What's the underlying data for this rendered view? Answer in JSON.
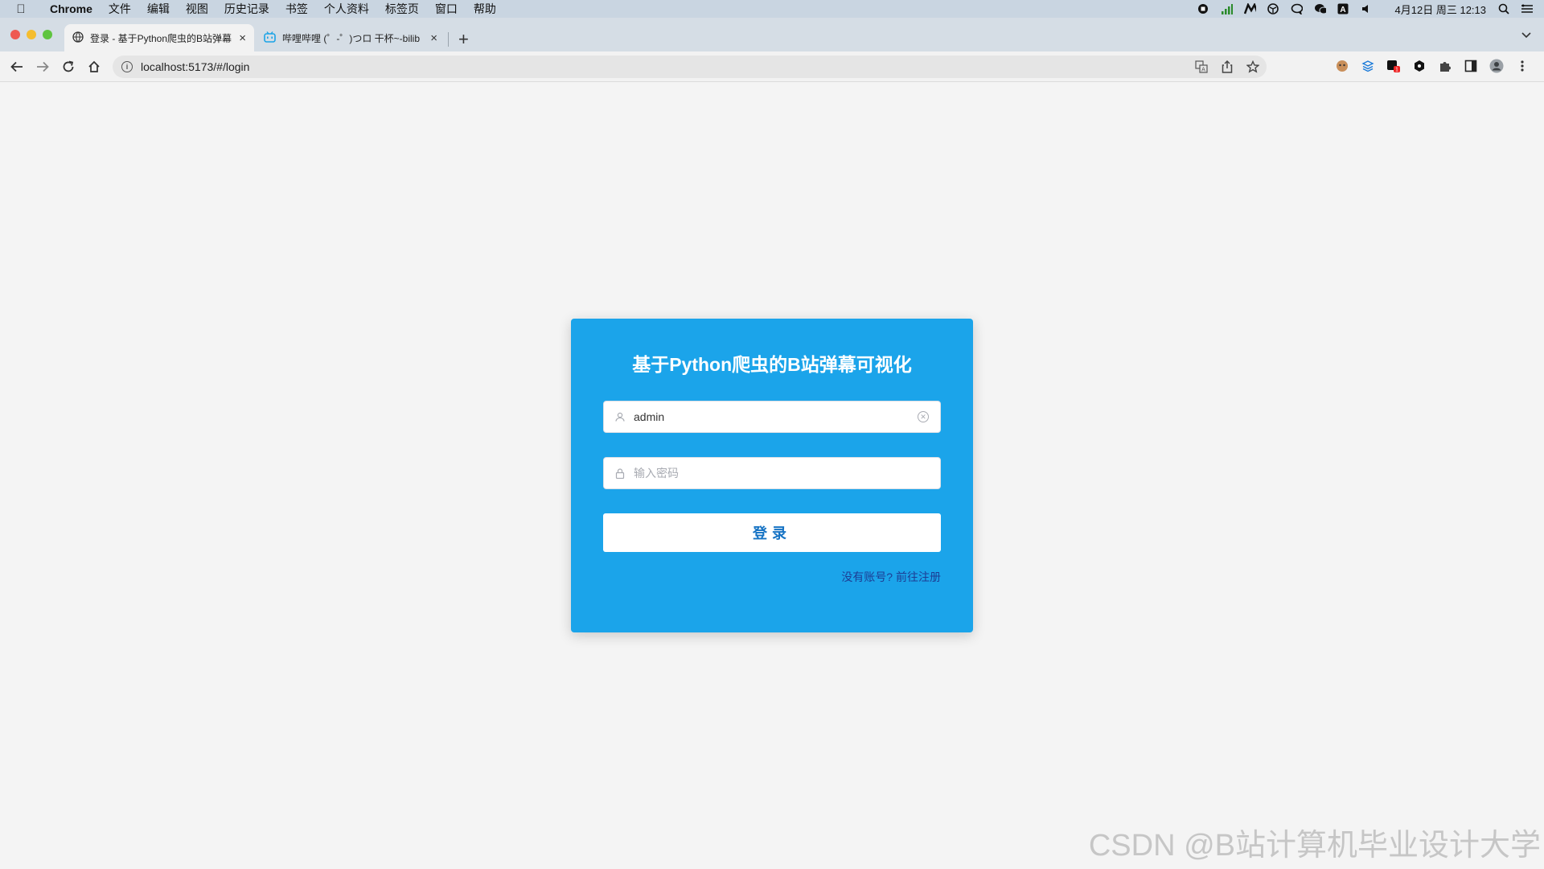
{
  "menubar": {
    "app_name": "Chrome",
    "items": [
      "文件",
      "编辑",
      "视图",
      "历史记录",
      "书签",
      "个人资料",
      "标签页",
      "窗口",
      "帮助"
    ],
    "clock": "4月12日 周三 12:13"
  },
  "tabs": [
    {
      "title": "登录 - 基于Python爬虫的B站弹幕",
      "close": "×",
      "favicon": "globe-icon"
    },
    {
      "title": "哔哩哔哩 (゜-゜)つロ 干杯~-bilib",
      "close": "×",
      "favicon": "bilibili-icon"
    }
  ],
  "new_tab": "+",
  "address_bar": {
    "url": "localhost:5173/#/login"
  },
  "login": {
    "title": "基于Python爬虫的B站弹幕可视化",
    "username_value": "admin",
    "password_placeholder": "输入密码",
    "submit_label": "登录",
    "register_link": "没有账号? 前往注册"
  },
  "watermark": "CSDN @B站计算机毕业设计大学"
}
